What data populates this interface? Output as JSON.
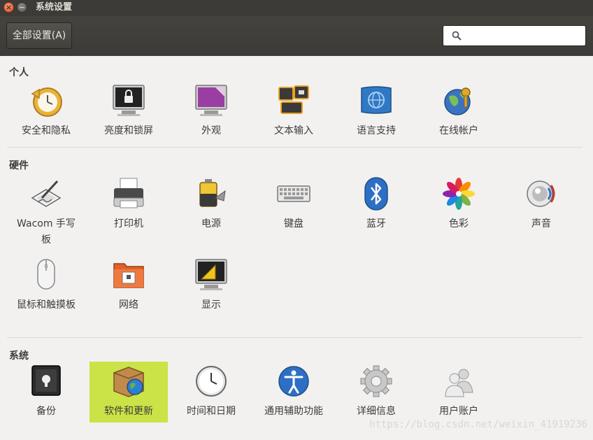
{
  "window": {
    "title": "系统设置"
  },
  "titlebar_buttons": {
    "close": "×",
    "minimize": "−"
  },
  "toolbar": {
    "all_settings_label": "全部设置(A)",
    "search_placeholder": "",
    "search_value": ""
  },
  "sections": {
    "personal": {
      "title": "个人",
      "items": [
        {
          "label": "安全和隐私",
          "icon": "security-privacy-icon"
        },
        {
          "label": "亮度和锁屏",
          "icon": "brightness-lock-icon"
        },
        {
          "label": "外观",
          "icon": "appearance-icon"
        },
        {
          "label": "文本输入",
          "icon": "text-entry-icon"
        },
        {
          "label": "语言支持",
          "icon": "language-support-icon"
        },
        {
          "label": "在线帐户",
          "icon": "online-accounts-icon"
        }
      ]
    },
    "hardware": {
      "title": "硬件",
      "items": [
        {
          "label": "Wacom 手写板",
          "icon": "wacom-tablet-icon"
        },
        {
          "label": "打印机",
          "icon": "printer-icon"
        },
        {
          "label": "电源",
          "icon": "power-icon"
        },
        {
          "label": "键盘",
          "icon": "keyboard-icon"
        },
        {
          "label": "蓝牙",
          "icon": "bluetooth-icon"
        },
        {
          "label": "色彩",
          "icon": "color-icon"
        },
        {
          "label": "声音",
          "icon": "sound-icon"
        },
        {
          "label": "鼠标和触摸板",
          "icon": "mouse-touchpad-icon"
        },
        {
          "label": "网络",
          "icon": "network-icon"
        },
        {
          "label": "显示",
          "icon": "display-icon"
        }
      ]
    },
    "system": {
      "title": "系统",
      "items": [
        {
          "label": "备份",
          "icon": "backup-icon"
        },
        {
          "label": "软件和更新",
          "icon": "software-updates-icon",
          "selected": true
        },
        {
          "label": "时间和日期",
          "icon": "time-date-icon"
        },
        {
          "label": "通用辅助功能",
          "icon": "universal-access-icon"
        },
        {
          "label": "详细信息",
          "icon": "details-icon"
        },
        {
          "label": "用户账户",
          "icon": "user-accounts-icon"
        }
      ]
    }
  },
  "colors": {
    "titlebar": "#3c3b37",
    "selection": "#cbe346",
    "background": "#f2f1f0"
  },
  "watermark": "https://blog.csdn.net/weixin_41919236"
}
